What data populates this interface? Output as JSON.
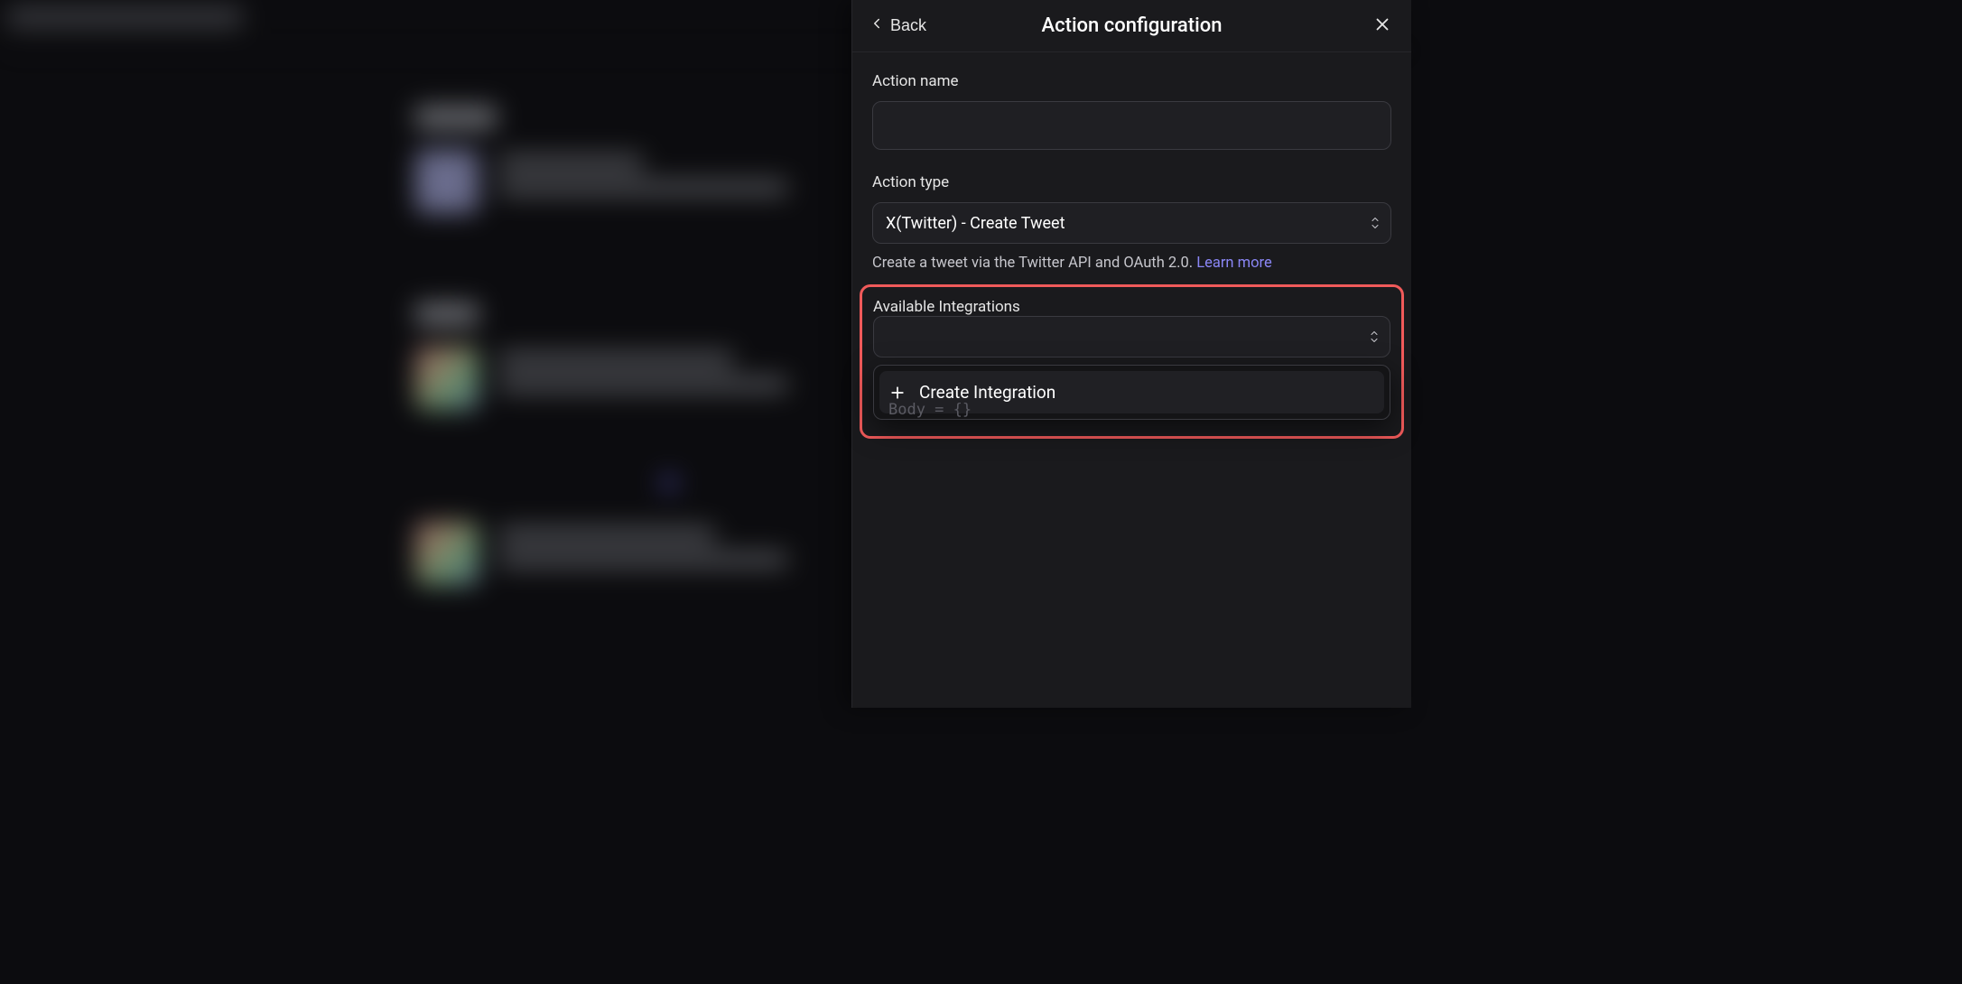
{
  "panel": {
    "back_label": "Back",
    "title": "Action configuration",
    "action_name_label": "Action name",
    "action_name_value": "",
    "action_type_label": "Action type",
    "action_type_selected": "X(Twitter) - Create Tweet",
    "helper_text": "Create a tweet via the Twitter API and OAuth 2.0. ",
    "learn_more_label": "Learn more",
    "integrations_label": "Available Integrations",
    "integrations_selected": "",
    "create_integration_label": "Create Integration",
    "peek_label": "Body = {}"
  }
}
